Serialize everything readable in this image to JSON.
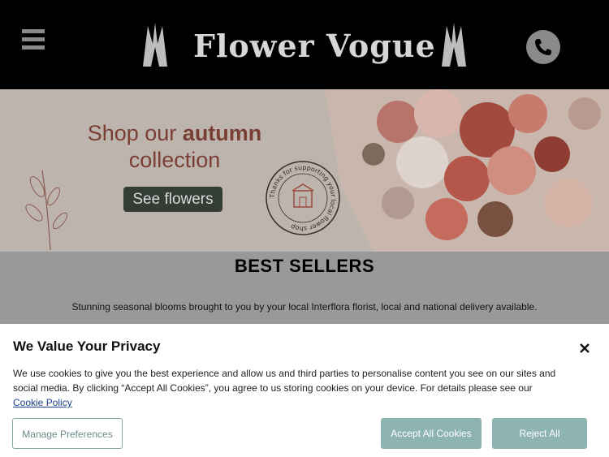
{
  "header": {
    "logo_text": "Flower Vogue",
    "menu_icon": "hamburger-menu-icon",
    "phone_icon": "phone-icon"
  },
  "banner": {
    "title_prefix": "Shop our ",
    "title_emphasis": "autumn",
    "title_suffix": "collection",
    "button_label": "See flowers",
    "stamp_text": "Thanks for supporting your local flower shop"
  },
  "best_sellers": {
    "title": "BEST SELLERS",
    "subtitle": "Stunning seasonal blooms brought to you by your local Interflora florist, local and national delivery available."
  },
  "cookie_banner": {
    "title": "We Value Your Privacy",
    "body": "We use cookies to give you the best experience and allow us and third parties to personalise content you see on our sites and social media. By clicking “Accept All Cookies”, you agree to us storing cookies on your device. For details please see our",
    "policy_link": "Cookie Policy",
    "manage_label": "Manage Preferences",
    "accept_label": "Accept All Cookies",
    "reject_label": "Reject All"
  },
  "colors": {
    "header_bg": "#000000",
    "accent_teal": "#8db3b2",
    "banner_text": "#7a3f34",
    "button_dark": "#333c35"
  }
}
